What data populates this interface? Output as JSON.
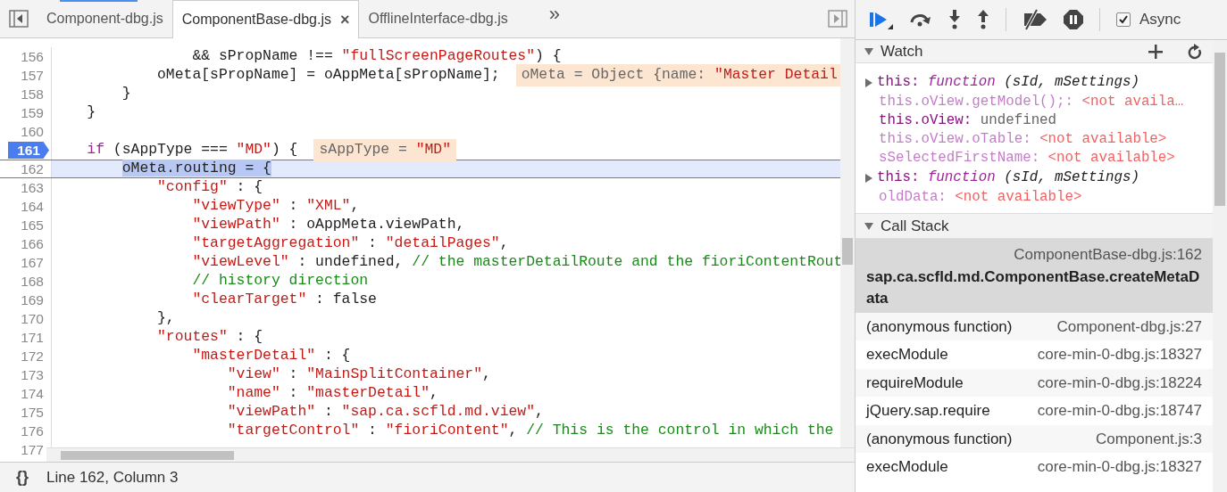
{
  "editor": {
    "tabs": [
      {
        "label": "Component-dbg.js",
        "selected": false
      },
      {
        "label": "ComponentBase-dbg.js",
        "selected": true,
        "close": "×"
      },
      {
        "label": "OfflineInterface-dbg.js",
        "selected": false
      }
    ],
    "overflow": "»",
    "lines": [
      {
        "number": "156",
        "breakpoint": false,
        "current": false,
        "tokens": [
          {
            "kind": "plain",
            "text": "                && sPropName !== "
          },
          {
            "kind": "string",
            "text": "\"fullScreenPageRoutes\""
          },
          {
            "kind": "plain",
            "text": ") {"
          }
        ]
      },
      {
        "number": "157",
        "breakpoint": false,
        "current": false,
        "tokens": [
          {
            "kind": "plain",
            "text": "            oMeta[sPropName] = oAppMeta[sPropName];"
          }
        ],
        "annotation": [
          {
            "kind": "value",
            "text": "oMeta = Object {name: "
          },
          {
            "kind": "string",
            "text": "\"Master Detail"
          }
        ]
      },
      {
        "number": "158",
        "breakpoint": false,
        "current": false,
        "tokens": [
          {
            "kind": "plain",
            "text": "        }"
          }
        ]
      },
      {
        "number": "159",
        "breakpoint": false,
        "current": false,
        "tokens": [
          {
            "kind": "plain",
            "text": "    }"
          }
        ]
      },
      {
        "number": "160",
        "breakpoint": false,
        "current": false
      },
      {
        "number": "161",
        "breakpoint": true,
        "current": false,
        "tokens": [
          {
            "kind": "keyword",
            "text": "    if"
          },
          {
            "kind": "plain",
            "text": " (sAppType === "
          },
          {
            "kind": "string",
            "text": "\"MD\""
          },
          {
            "kind": "plain",
            "text": ") {"
          }
        ],
        "annotation": [
          {
            "kind": "value",
            "text": "sAppType = "
          },
          {
            "kind": "string",
            "text": "\"MD\""
          }
        ]
      },
      {
        "number": "162",
        "breakpoint": false,
        "current": true,
        "tokens": [
          {
            "kind": "plain",
            "text": "        oMeta.routing = {"
          }
        ]
      },
      {
        "number": "163",
        "breakpoint": false,
        "current": false,
        "tokens": [
          {
            "kind": "string",
            "text": "            \"config\""
          },
          {
            "kind": "plain",
            "text": " : {"
          }
        ]
      },
      {
        "number": "164",
        "breakpoint": false,
        "current": false,
        "tokens": [
          {
            "kind": "string",
            "text": "                \"viewType\""
          },
          {
            "kind": "plain",
            "text": " : "
          },
          {
            "kind": "string",
            "text": "\"XML\""
          },
          {
            "kind": "plain",
            "text": ","
          }
        ]
      },
      {
        "number": "165",
        "breakpoint": false,
        "current": false,
        "tokens": [
          {
            "kind": "string",
            "text": "                \"viewPath\""
          },
          {
            "kind": "plain",
            "text": " : oAppMeta.viewPath,"
          }
        ]
      },
      {
        "number": "166",
        "breakpoint": false,
        "current": false,
        "tokens": [
          {
            "kind": "string",
            "text": "                \"targetAggregation\""
          },
          {
            "kind": "plain",
            "text": " : "
          },
          {
            "kind": "string",
            "text": "\"detailPages\""
          },
          {
            "kind": "plain",
            "text": ","
          }
        ]
      },
      {
        "number": "167",
        "breakpoint": false,
        "current": false,
        "tokens": [
          {
            "kind": "string",
            "text": "                \"viewLevel\""
          },
          {
            "kind": "plain",
            "text": " : undefined, "
          },
          {
            "kind": "comment",
            "text": "// the masterDetailRoute and the fioriContentRout"
          }
        ]
      },
      {
        "number": "168",
        "breakpoint": false,
        "current": false,
        "tokens": [
          {
            "kind": "comment",
            "text": "                // history direction"
          }
        ]
      },
      {
        "number": "169",
        "breakpoint": false,
        "current": false,
        "tokens": [
          {
            "kind": "string",
            "text": "                \"clearTarget\""
          },
          {
            "kind": "plain",
            "text": " : false"
          }
        ]
      },
      {
        "number": "170",
        "breakpoint": false,
        "current": false,
        "tokens": [
          {
            "kind": "plain",
            "text": "            },"
          }
        ]
      },
      {
        "number": "171",
        "breakpoint": false,
        "current": false,
        "tokens": [
          {
            "kind": "string",
            "text": "            \"routes\""
          },
          {
            "kind": "plain",
            "text": " : {"
          }
        ]
      },
      {
        "number": "172",
        "breakpoint": false,
        "current": false,
        "tokens": [
          {
            "kind": "string",
            "text": "                \"masterDetail\""
          },
          {
            "kind": "plain",
            "text": " : {"
          }
        ]
      },
      {
        "number": "173",
        "breakpoint": false,
        "current": false,
        "tokens": [
          {
            "kind": "string",
            "text": "                    \"view\""
          },
          {
            "kind": "plain",
            "text": " : "
          },
          {
            "kind": "string",
            "text": "\"MainSplitContainer\""
          },
          {
            "kind": "plain",
            "text": ","
          }
        ]
      },
      {
        "number": "174",
        "breakpoint": false,
        "current": false,
        "tokens": [
          {
            "kind": "string",
            "text": "                    \"name\""
          },
          {
            "kind": "plain",
            "text": " : "
          },
          {
            "kind": "string",
            "text": "\"masterDetail\""
          },
          {
            "kind": "plain",
            "text": ","
          }
        ]
      },
      {
        "number": "175",
        "breakpoint": false,
        "current": false,
        "tokens": [
          {
            "kind": "string",
            "text": "                    \"viewPath\""
          },
          {
            "kind": "plain",
            "text": " : "
          },
          {
            "kind": "string",
            "text": "\"sap.ca.scfld.md.view\""
          },
          {
            "kind": "plain",
            "text": ","
          }
        ]
      },
      {
        "number": "176",
        "breakpoint": false,
        "current": false,
        "tokens": [
          {
            "kind": "string",
            "text": "                    \"targetControl\""
          },
          {
            "kind": "plain",
            "text": " : "
          },
          {
            "kind": "string",
            "text": "\"fioriContent\""
          },
          {
            "kind": "plain",
            "text": ", "
          },
          {
            "kind": "comment",
            "text": "// This is the control in which the"
          }
        ]
      },
      {
        "number": "177",
        "breakpoint": false,
        "current": false
      }
    ]
  },
  "status_bar": {
    "format_button": "{}",
    "position": "Line 162, Column 3"
  },
  "debugger": {
    "async": {
      "label": "Async",
      "checked": true
    },
    "watch": {
      "title": "Watch",
      "expanded": true,
      "items": [
        {
          "kind": "expandable",
          "expanded": false,
          "name": "this:",
          "keyword": "function",
          "value": "(sId, mSettings)"
        },
        {
          "kind": "unavailable",
          "name": "this.oView.getModel();:",
          "value": "<not availa…"
        },
        {
          "kind": "value",
          "name": "this.oView:",
          "value": "undefined"
        },
        {
          "kind": "unavailable",
          "name": "this.oView.oTable:",
          "value": "<not available>"
        },
        {
          "kind": "unavailable",
          "name": "sSelectedFirstName:",
          "value": "<not available>"
        },
        {
          "kind": "expandable",
          "expanded": false,
          "name": "this:",
          "keyword": "function",
          "value": "(sId, mSettings)"
        },
        {
          "kind": "unavailable",
          "name": "oldData:",
          "value": "<not available>"
        }
      ]
    },
    "call_stack": {
      "title": "Call Stack",
      "expanded": true,
      "frames": [
        {
          "function": "sap.ca.scfld.md.ComponentBase.createMetaData",
          "location": "ComponentBase-dbg.js:162",
          "selected": true
        },
        {
          "function": "(anonymous function)",
          "location": "Component-dbg.js:27",
          "selected": false
        },
        {
          "function": "execModule",
          "location": "core-min-0-dbg.js:18327",
          "selected": false
        },
        {
          "function": "requireModule",
          "location": "core-min-0-dbg.js:18224",
          "selected": false
        },
        {
          "function": "jQuery.sap.require",
          "location": "core-min-0-dbg.js:18747",
          "selected": false
        },
        {
          "function": "(anonymous function)",
          "location": "Component.js:3",
          "selected": false
        },
        {
          "function": "execModule",
          "location": "core-min-0-dbg.js:18327",
          "selected": false
        }
      ]
    }
  }
}
